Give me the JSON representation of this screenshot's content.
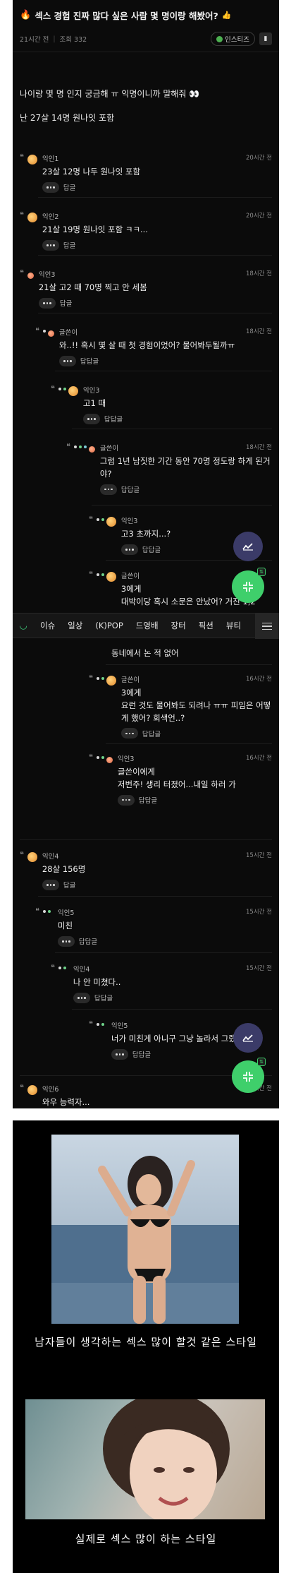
{
  "post": {
    "title": "섹스 경험 진짜 많다 싶은 사람 몇 명이랑 해봤어?",
    "time": "21시간 전",
    "views": "조회 332",
    "badge": "인스티즈",
    "body": [
      "나이랑 몇 명 인지 궁금해 ㅠ 익명이니까 말해줘",
      "난 27살 14명 원나잇 포함"
    ]
  },
  "comments": [
    {
      "author": "익인1",
      "time": "20시간 전",
      "text": "23살 12명 나두 원나잇 포함",
      "action": "답글"
    },
    {
      "author": "익인2",
      "time": "20시간 전",
      "text": "21살 19명 원나잇 포함 ㅋㅋ...",
      "action": "답글"
    },
    {
      "author": "익인3",
      "time": "18시간 전",
      "text": "21살 고2 때 70명 찍고 안 세봄",
      "action": "답글"
    },
    {
      "author": "글쓴이",
      "time": "18시간 전",
      "text": "와..!! 혹시 몇 살 때 첫 경험이었어? 물어봐두될까ㅠ",
      "action": "답답글"
    },
    {
      "author": "익인3",
      "time": "",
      "text": "고1 때",
      "action": "답답글"
    },
    {
      "author": "글쓴이",
      "time": "18시간 전",
      "text": "그럼 1년 남짓한 기간 동안 70명 정도랑 하게 된거야?",
      "action": "답답글"
    },
    {
      "author": "익인3",
      "time": "",
      "text": "고3 초까지...?",
      "action": "답답글"
    },
    {
      "author": "글쓴이",
      "time": "",
      "text": "3에게",
      "action": ""
    },
    {
      "author": "",
      "time": "",
      "text": "대박이당 혹시 소문은 안났어? 거진 1,2",
      "action": ""
    },
    {
      "author": "",
      "time": "",
      "text": "동네에서 논 적 없어",
      "action": ""
    },
    {
      "author": "글쓴이",
      "time": "16시간 전",
      "text": "3에게",
      "action": ""
    },
    {
      "author": "",
      "time": "",
      "text": "요런 것도 물어봐도 되려나 ㅠㅠ 피임은 어떻게 했어? 회색언..?",
      "action": "답답글"
    },
    {
      "author": "익인3",
      "time": "16시간 전",
      "text": "글쓴이에게",
      "action": ""
    },
    {
      "author": "",
      "time": "",
      "text": "저번주! 생리 터졌어...내일 하러 가",
      "action": "답답글"
    },
    {
      "author": "익인4",
      "time": "15시간 전",
      "text": "28살 156명",
      "action": "답글"
    },
    {
      "author": "익인5",
      "time": "15시간 전",
      "text": "미친",
      "action": "답답글"
    },
    {
      "author": "익인4",
      "time": "15시간 전",
      "text": "나 안 미쳤다..",
      "action": "답답글"
    },
    {
      "author": "익인5",
      "time": "",
      "text": "너가 미친게 아니구 그냥 놀라서 그랬",
      "action": "답답글"
    },
    {
      "author": "익인6",
      "time": "15시간 전",
      "text": "와우 능력자...",
      "action": ""
    }
  ],
  "nav": {
    "items": [
      "이슈",
      "일상",
      "(K)POP",
      "드영배",
      "장터",
      "픽션",
      "뷰티"
    ]
  },
  "meme": {
    "caption1": "남자들이 생각하는 섹스 많이 할것 같은 스타일",
    "caption2": "실제로 섹스 많이 하는 스타일"
  },
  "icons": {
    "flame": "flame-icon",
    "bookmark": "bookmark-icon",
    "chart": "chart-icon",
    "collapse": "collapse-icon",
    "home": "home-icon",
    "menu": "menu-icon"
  },
  "colors": {
    "background": "#0b0b0b",
    "accent_green": "#3fcf6b",
    "fab_purple": "#3b3b68"
  }
}
